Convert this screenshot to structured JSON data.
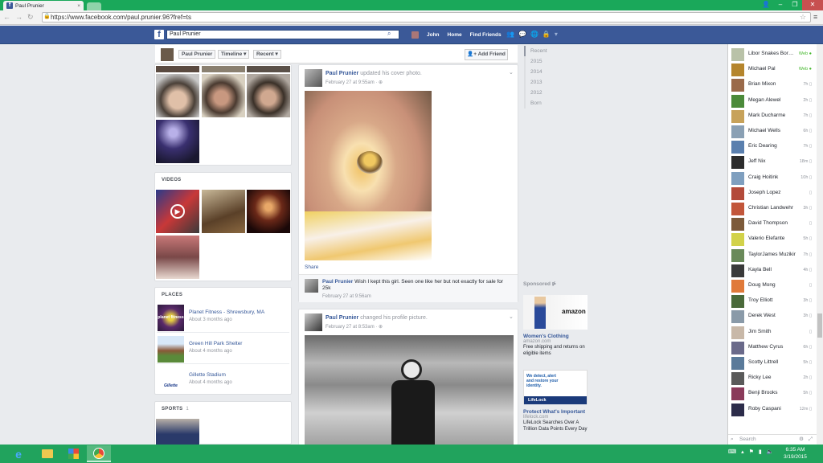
{
  "browser": {
    "tab_title": "Paul Prunier",
    "url": "https://www.facebook.com/paul.prunier.96?fref=ts"
  },
  "fb_header": {
    "search_value": "Paul Prunier",
    "nav_items": [
      "John",
      "Home",
      "Find Friends"
    ]
  },
  "timeline_bar": {
    "name": "Paul Prunier",
    "timeline_label": "Timeline",
    "recent_label": "Recent",
    "add_friend_label": "Add Friend"
  },
  "videos": {
    "title": "VIDEOS"
  },
  "places": {
    "title": "PLACES",
    "items": [
      {
        "name": "Planet Fitness - Shrewsbury, MA",
        "time": "About 3 months ago",
        "thumb_text": "planet fitness"
      },
      {
        "name": "Green Hill Park Shelter",
        "time": "About 4 months ago"
      },
      {
        "name": "Gillette Stadium",
        "time": "About 4 months ago",
        "thumb_text": "Gillette"
      }
    ]
  },
  "sports": {
    "title": "SPORTS",
    "count": "1"
  },
  "posts": [
    {
      "author": "Paul Prunier",
      "action": "updated his cover photo.",
      "date": "February 27 at 9:55am",
      "share_label": "Share",
      "comment": {
        "author": "Paul Prunier",
        "text": "Wish I kept this girl. Seen one like her but not exactly for sale for 25k",
        "date": "February 27 at 9:56am"
      }
    },
    {
      "author": "Paul Prunier",
      "action": "changed his profile picture.",
      "date": "February 27 at 8:53am"
    }
  ],
  "years": [
    "Recent",
    "2015",
    "2014",
    "2013",
    "2012",
    "Born"
  ],
  "sponsored": {
    "label": "Sponsored",
    "ads": [
      {
        "title": "Women's Clothing",
        "url": "amazon.com",
        "desc": "Free shipping and returns on eligible items",
        "brand": "amazon"
      },
      {
        "title": "Protect What's Important",
        "url": "lifelock.com",
        "desc": "LifeLock Searches Over A Trillion Data Points Every Day",
        "brand": "LifeLock",
        "banner": "We detect, alert and restore your identity."
      }
    ]
  },
  "chat": {
    "search_placeholder": "Search",
    "friends": [
      {
        "name": "Libor Snakes Bor…",
        "status": "Web",
        "color": "#b9c2a8"
      },
      {
        "name": "Michael Pal",
        "status": "Web",
        "color": "#b5852c"
      },
      {
        "name": "Brian Mixon",
        "status": "7h",
        "color": "#9a6a4a"
      },
      {
        "name": "Megan Alewel",
        "status": "2h",
        "color": "#4b8a3a"
      },
      {
        "name": "Mark Ducharme",
        "status": "7h",
        "color": "#c7a25a"
      },
      {
        "name": "Michael Wells",
        "status": "6h",
        "color": "#8aa0b4"
      },
      {
        "name": "Eric Dearing",
        "status": "7h",
        "color": "#5a7fae"
      },
      {
        "name": "Jeff Nix",
        "status": "18m",
        "color": "#2c2c2c"
      },
      {
        "name": "Craig Hoitink",
        "status": "10h",
        "color": "#7f9fbf"
      },
      {
        "name": "Joseph Lopez",
        "status": "",
        "color": "#b34a3a"
      },
      {
        "name": "Christian Landwehr",
        "status": "3h",
        "color": "#c2563a"
      },
      {
        "name": "David Thompson",
        "status": "",
        "color": "#7c5a3a"
      },
      {
        "name": "Valerio Elefante",
        "status": "5h",
        "color": "#d2d24a"
      },
      {
        "name": "TaylorJames Muzikir",
        "status": "7h",
        "color": "#6a8a5a"
      },
      {
        "name": "Kayla Bell",
        "status": "4h",
        "color": "#3a3a3a"
      },
      {
        "name": "Doug Mong",
        "status": "",
        "color": "#e07a3a"
      },
      {
        "name": "Troy Elliott",
        "status": "3h",
        "color": "#4a6a3a"
      },
      {
        "name": "Derek West",
        "status": "3h",
        "color": "#8a9aa8"
      },
      {
        "name": "Jim Smith",
        "status": "",
        "color": "#c8b8a8"
      },
      {
        "name": "Matthew Cyrus",
        "status": "6h",
        "color": "#6a6a8a"
      },
      {
        "name": "Scotty Littrell",
        "status": "5h",
        "color": "#5a7a9a"
      },
      {
        "name": "Ricky Lee",
        "status": "2h",
        "color": "#5a5a5a"
      },
      {
        "name": "Benji Brooks",
        "status": "5h",
        "color": "#8a3a5a"
      },
      {
        "name": "Roby Caspani",
        "status": "12m",
        "color": "#2c2c4a"
      }
    ]
  },
  "taskbar": {
    "time": "6:35 AM",
    "date": "3/19/2015"
  }
}
